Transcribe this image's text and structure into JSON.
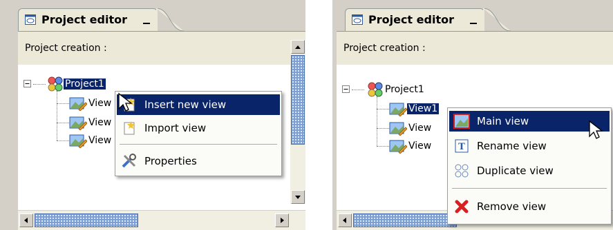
{
  "left_panel": {
    "tab_title": "Project editor",
    "header_label": "Project creation :",
    "tree": {
      "root": "Project1",
      "children": [
        "View",
        "View",
        "View"
      ]
    },
    "context_menu": {
      "items": [
        "Insert new view",
        "Import view",
        "Properties"
      ],
      "highlighted": "Insert new view"
    }
  },
  "right_panel": {
    "tab_title": "Project editor",
    "header_label": "Project creation :",
    "tree": {
      "root": "Project1",
      "children": [
        "View1",
        "View",
        "View"
      ]
    },
    "context_menu": {
      "items": [
        "Main view",
        "Rename view",
        "Duplicate view",
        "Remove view"
      ],
      "highlighted": "Main view",
      "icons": [
        "main-view-icon",
        "rename-icon",
        "duplicate-icon",
        "remove-icon"
      ]
    }
  },
  "colors": {
    "selection": "#0a246a",
    "scroll_thumb": "#7c9fd4",
    "panel_bg": "#d4d0c8"
  }
}
